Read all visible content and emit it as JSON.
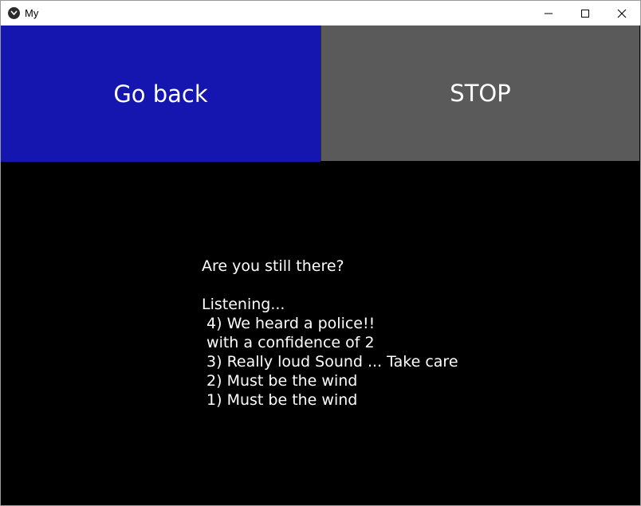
{
  "window": {
    "title": "My"
  },
  "buttons": {
    "go_back_label": "Go back",
    "stop_label": "STOP"
  },
  "messages": {
    "prompt": "Are you still there?",
    "status": "Listening...",
    "log": [
      " 4) We heard a police!!",
      " with a confidence of 2",
      " 3) Really loud Sound ... Take care",
      " 2) Must be the wind",
      " 1) Must be the wind"
    ]
  },
  "colors": {
    "go_back_bg": "#1515b0",
    "stop_bg": "#5a5a5a",
    "content_bg": "#000000",
    "text": "#ffffff"
  },
  "icons": {
    "app": "app-icon",
    "minimize": "minimize-icon",
    "maximize": "maximize-icon",
    "close": "close-icon"
  }
}
